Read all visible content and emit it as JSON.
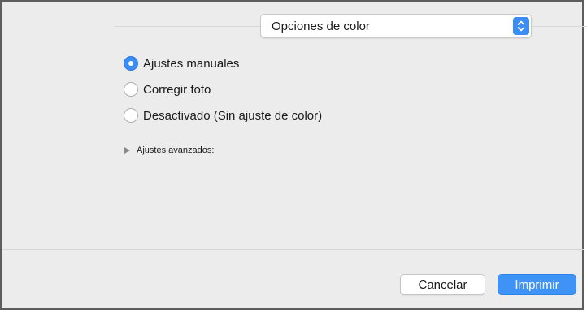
{
  "popup": {
    "selected_value": "Opciones de color",
    "icon": "up-down-chevron-icon"
  },
  "color_mode": {
    "options": [
      {
        "label": "Ajustes manuales",
        "checked": true
      },
      {
        "label": "Corregir foto",
        "checked": false
      },
      {
        "label": "Desactivado (Sin ajuste de color)",
        "checked": false
      }
    ]
  },
  "advanced": {
    "label": "Ajustes avanzados:",
    "expanded": false,
    "icon": "disclosure-triangle-icon"
  },
  "buttons": {
    "cancel_label": "Cancelar",
    "print_label": "Imprimir"
  },
  "colors": {
    "accent": "#3b8cf4",
    "panel_background": "#ececec"
  }
}
